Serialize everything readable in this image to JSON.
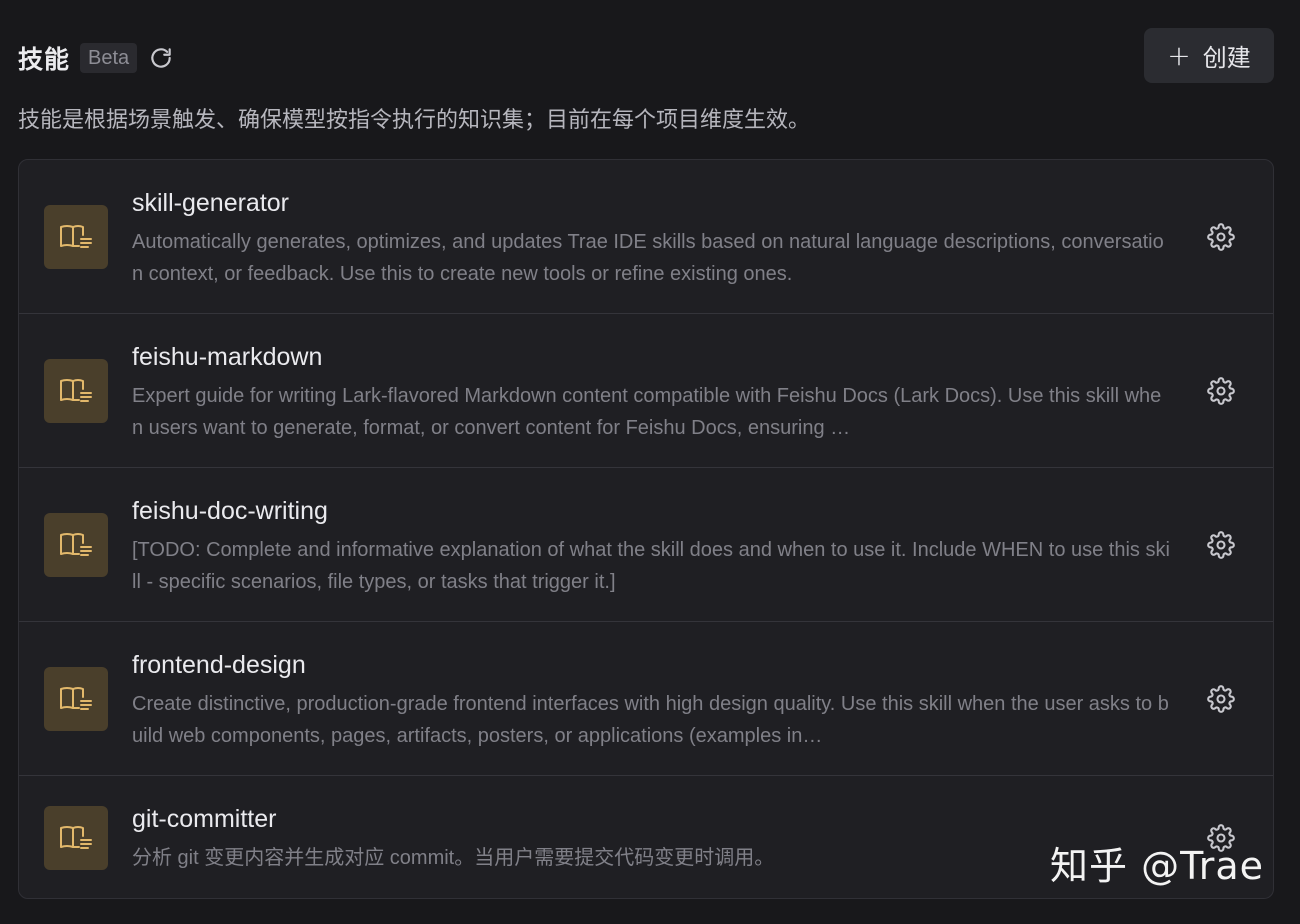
{
  "header": {
    "title": "技能",
    "badge": "Beta",
    "create_label": "创建",
    "create_icon": "+"
  },
  "description": "技能是根据场景触发、确保模型按指令执行的知识集；目前在每个项目维度生效。",
  "skills": [
    {
      "name": "skill-generator",
      "description": "Automatically generates, optimizes, and updates Trae IDE skills based on natural language descriptions, conversation context, or feedback. Use this to create new tools or refine existing ones."
    },
    {
      "name": "feishu-markdown",
      "description": "Expert guide for writing Lark-flavored Markdown content compatible with Feishu Docs (Lark Docs). Use this skill when users want to generate, format, or convert content for Feishu Docs, ensuring …"
    },
    {
      "name": "feishu-doc-writing",
      "description": "[TODO: Complete and informative explanation of what the skill does and when to use it. Include WHEN to use this skill - specific scenarios, file types, or tasks that trigger it.]"
    },
    {
      "name": "frontend-design",
      "description": "Create distinctive, production-grade frontend interfaces with high design quality. Use this skill when the user asks to build web components, pages, artifacts, posters, or applications (examples in…"
    },
    {
      "name": "git-committer",
      "description": "分析 git 变更内容并生成对应 commit。当用户需要提交代码变更时调用。"
    }
  ],
  "watermark": "知乎 @Trae",
  "colors": {
    "background": "#18181b",
    "card": "#1f1f23",
    "icon_bg": "#4a3f2b",
    "icon_fg": "#e2b86b"
  },
  "icons": {
    "refresh": "refresh-icon",
    "skill": "book-icon",
    "settings": "gear-icon"
  }
}
